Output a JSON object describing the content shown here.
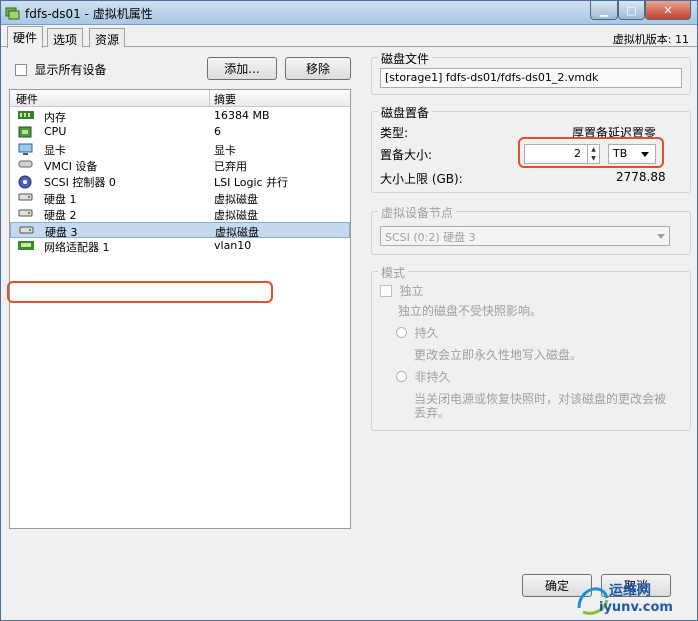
{
  "window": {
    "title": "fdfs-ds01 - 虚拟机属性"
  },
  "tabs": [
    {
      "label": "硬件"
    },
    {
      "label": "选项"
    },
    {
      "label": "资源"
    }
  ],
  "version_label": "虚拟机版本: 11",
  "left": {
    "show_all_label": "显示所有设备",
    "add_label": "添加...",
    "remove_label": "移除",
    "columns": [
      "硬件",
      "摘要"
    ],
    "rows": [
      {
        "icon": "memory-icon",
        "name": "内存",
        "summary": "16384 MB"
      },
      {
        "icon": "cpu-icon",
        "name": "CPU",
        "summary": "6"
      },
      {
        "icon": "display-icon",
        "name": "显卡",
        "summary": "显卡"
      },
      {
        "icon": "vmci-icon",
        "name": "VMCI 设备",
        "summary": "已弃用"
      },
      {
        "icon": "scsi-controller-icon",
        "name": "SCSI 控制器 0",
        "summary": "LSI Logic 并行"
      },
      {
        "icon": "hard-disk-icon",
        "name": "硬盘 1",
        "summary": "虚拟磁盘"
      },
      {
        "icon": "hard-disk-icon",
        "name": "硬盘 2",
        "summary": "虚拟磁盘"
      },
      {
        "icon": "hard-disk-icon",
        "name": "硬盘 3",
        "summary": "虚拟磁盘"
      },
      {
        "icon": "network-adapter-icon",
        "name": "网络适配器 1",
        "summary": "vlan10"
      }
    ],
    "selected_index": 7
  },
  "disk_file": {
    "title": "磁盘文件",
    "path": "[storage1] fdfs-ds01/fdfs-ds01_2.vmdk"
  },
  "provisioning": {
    "title": "磁盘置备",
    "type_label": "类型:",
    "type_value": "厚置备延迟置零",
    "size_label": "置备大小:",
    "size_value": "2",
    "unit_value": "TB",
    "max_label": "大小上限 (GB):",
    "max_value": "2778.88"
  },
  "device_node": {
    "title": "虚拟设备节点",
    "value": "SCSI (0:2) 硬盘 3"
  },
  "mode": {
    "title": "模式",
    "independent_label": "独立",
    "independent_desc": "独立的磁盘不受快照影响。",
    "persistent_label": "持久",
    "persistent_desc": "更改会立即永久性地写入磁盘。",
    "nonpersistent_label": "非持久",
    "nonpersistent_desc_1": "当关闭电源或恢复快照时，对该磁盘的更改会被",
    "nonpersistent_desc_2": "丢弃。"
  },
  "footer": {
    "ok_label": "确定",
    "cancel_label": "取消"
  },
  "watermark": {
    "line1": "运维网",
    "line2": "iyunv.com"
  },
  "colors": {
    "highlight": "#e0502a",
    "selection": "#c5d9ef"
  }
}
